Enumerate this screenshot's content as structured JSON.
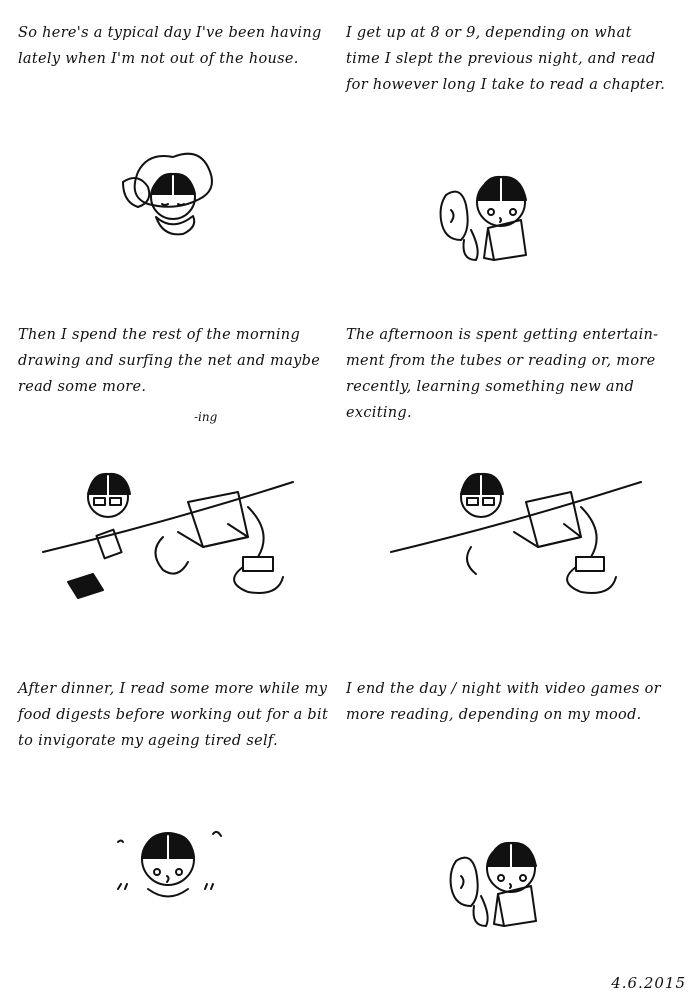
{
  "panels": [
    {
      "caption": "So here's a typical day I've been having lately when I'm not out of the house."
    },
    {
      "caption": "I get up at 8 or 9, depending on what time I slept the previous night, and read for however long I take to read a chapter."
    },
    {
      "caption": "Then I spend the rest of the morning drawing and surfing the net and maybe read some more.",
      "insert": "-ing"
    },
    {
      "caption": "The afternoon is spent getting entertain-ment from the tubes or reading or, more recently, learning something new and exciting."
    },
    {
      "caption": "After dinner, I read some more while my food digests before working out for a bit to invigorate my ageing tired self."
    },
    {
      "caption": "I end the day / night with video games or more reading, depending on my mood."
    }
  ],
  "date": "4.6.2015"
}
